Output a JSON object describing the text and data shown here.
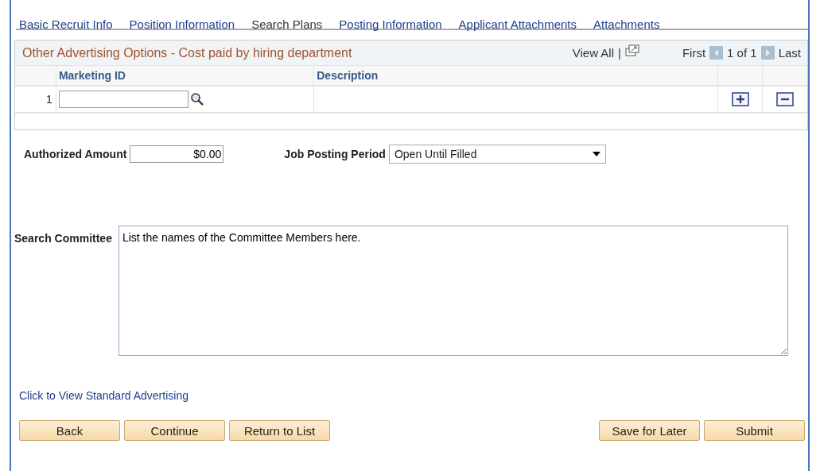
{
  "tabs": [
    {
      "label": "Basic Recruit Info",
      "selected": false
    },
    {
      "label": "Position Information",
      "selected": false
    },
    {
      "label": "Search Plans",
      "selected": true
    },
    {
      "label": "Posting Information",
      "selected": false
    },
    {
      "label": "Applicant Attachments",
      "selected": false
    },
    {
      "label": "Attachments",
      "selected": false
    }
  ],
  "grid": {
    "title": "Other Advertising Options - Cost paid by hiring department",
    "view_all": "View All",
    "separator": "|",
    "first": "First",
    "page": "1 of 1",
    "last": "Last",
    "columns": [
      "Marketing ID",
      "Description"
    ],
    "rows": [
      {
        "number": "1",
        "marketing_id": ""
      }
    ]
  },
  "authorized_amount": {
    "label": "Authorized Amount",
    "value": "$0.00"
  },
  "job_posting_period": {
    "label": "Job Posting Period",
    "value": "Open Until Filled"
  },
  "search_committee": {
    "label": "Search Committee",
    "value": "List the names of the Committee Members here."
  },
  "link": "Click to View Standard Advertising",
  "buttons_left": [
    "Back",
    "Continue",
    "Return to List"
  ],
  "buttons_right": [
    "Save for Later",
    "Submit"
  ]
}
